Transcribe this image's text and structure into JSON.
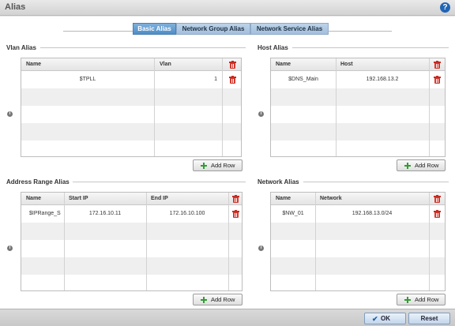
{
  "window": {
    "title": "Alias"
  },
  "tabs": [
    {
      "label": "Basic Alias",
      "active": true
    },
    {
      "label": "Network Group Alias",
      "active": false
    },
    {
      "label": "Network Service Alias",
      "active": false
    }
  ],
  "vlan_alias": {
    "title": "Vlan Alias",
    "columns": [
      "Name",
      "Vlan"
    ],
    "rows": [
      {
        "name": "$TPLL",
        "vlan": "1"
      }
    ],
    "add_row_label": "Add Row"
  },
  "host_alias": {
    "title": "Host Alias",
    "columns": [
      "Name",
      "Host"
    ],
    "rows": [
      {
        "name": "$DNS_Main",
        "host": "192.168.13.2"
      }
    ],
    "add_row_label": "Add Row"
  },
  "address_range_alias": {
    "title": "Address Range Alias",
    "columns": [
      "Name",
      "Start IP",
      "End IP"
    ],
    "rows": [
      {
        "name": "$IPRange_S",
        "start_ip": "172.16.10.11",
        "end_ip": "172.16.10.100"
      }
    ],
    "add_row_label": "Add Row"
  },
  "network_alias": {
    "title": "Network Alias",
    "columns": [
      "Name",
      "Network"
    ],
    "rows": [
      {
        "name": "$NW_01",
        "network": "192.168.13.0/24"
      }
    ],
    "add_row_label": "Add Row"
  },
  "footer": {
    "ok_label": "OK",
    "reset_label": "Reset"
  },
  "icons": {
    "help": "help-icon",
    "info": "info-icon",
    "delete": "trash-icon",
    "add": "plus-icon"
  },
  "colors": {
    "delete_icon": "#d33a2f",
    "add_icon": "#2f9e2f",
    "active_tab": "#4f8dc7",
    "help_icon": "#1f64b4"
  }
}
